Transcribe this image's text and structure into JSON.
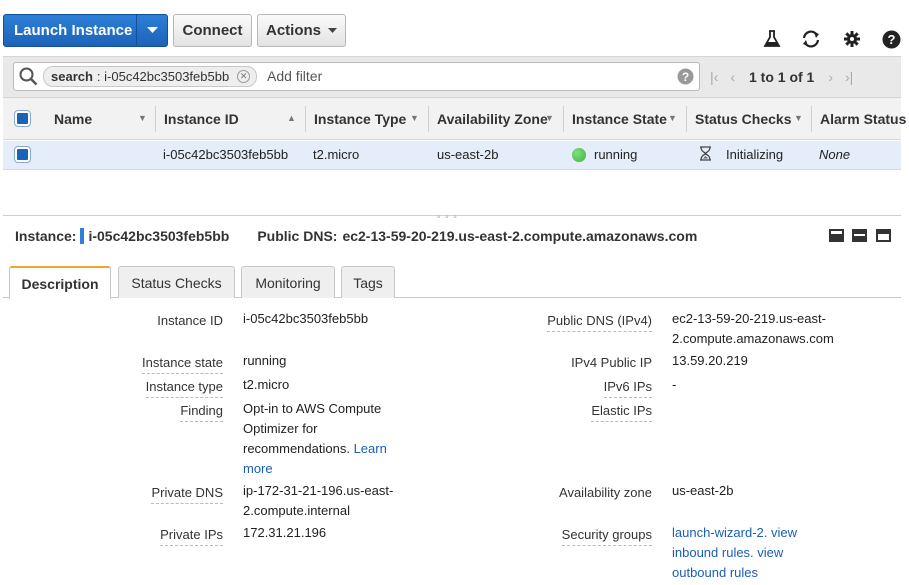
{
  "toolbar": {
    "launch_label": "Launch Instance",
    "connect_label": "Connect",
    "actions_label": "Actions"
  },
  "filter": {
    "token_key": "search",
    "token_value": ": i-05c42bc3503feb5bb",
    "placeholder": "Add filter",
    "pager_text": "1 to 1 of 1"
  },
  "table": {
    "columns": [
      "Name",
      "Instance ID",
      "Instance Type",
      "Availability Zone",
      "Instance State",
      "Status Checks",
      "Alarm Status"
    ],
    "row": {
      "name": "",
      "instance_id": "i-05c42bc3503feb5bb",
      "instance_type": "t2.micro",
      "availability_zone": "us-east-2b",
      "instance_state": "running",
      "status_checks": "Initializing",
      "alarm_status": "None",
      "state_color": "#3bb33b"
    }
  },
  "details": {
    "instance_label": "Instance:",
    "instance_id": "i-05c42bc3503feb5bb",
    "public_dns_label": "Public DNS:",
    "public_dns": "ec2-13-59-20-219.us-east-2.compute.amazonaws.com",
    "tabs": [
      "Description",
      "Status Checks",
      "Monitoring",
      "Tags"
    ]
  },
  "description": {
    "left": [
      {
        "label": "Instance ID",
        "lines": [
          "i-05c42bc3503feb5bb"
        ]
      },
      {
        "label": "Instance state",
        "lines": [
          "running"
        ]
      },
      {
        "label": "Instance type",
        "lines": [
          "t2.micro"
        ]
      },
      {
        "label": "Finding",
        "lines": [
          "Opt-in to AWS Compute",
          "Optimizer for",
          "recommendations."
        ],
        "link_inline": "Learn",
        "link_next": "more"
      },
      {
        "label": "Private DNS",
        "lines": [
          "ip-172-31-21-196.us-east-",
          "2.compute.internal"
        ]
      },
      {
        "label": "Private IPs",
        "lines": [
          "172.31.21.196"
        ]
      }
    ],
    "right": [
      {
        "label": "Public DNS (IPv4)",
        "lines": [
          "ec2-13-59-20-219.us-east-",
          "2.compute.amazonaws.com"
        ]
      },
      {
        "label": "IPv4 Public IP",
        "lines": [
          "13.59.20.219"
        ]
      },
      {
        "label": "IPv6 IPs",
        "lines": [
          "-"
        ]
      },
      {
        "label": "Elastic IPs",
        "lines": [
          ""
        ]
      },
      {
        "label": "Availability zone",
        "lines": [
          "us-east-2b"
        ]
      },
      {
        "label": "Security groups",
        "link_lines": [
          "launch-wizard-2. view",
          "inbound rules. view",
          "outbound rules"
        ]
      }
    ]
  },
  "colors": {
    "primary": "#1b63b8",
    "link": "#1a5fb4",
    "tab_accent": "#f0a530",
    "row_selected": "#e4edf9"
  }
}
